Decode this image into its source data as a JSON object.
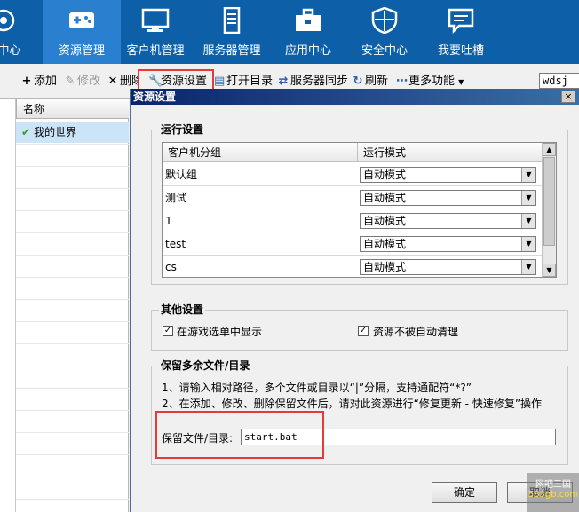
{
  "topnav": {
    "items": [
      {
        "label": "费中心",
        "icon": "eye-icon"
      },
      {
        "label": "资源管理",
        "icon": "gamepad-icon",
        "active": true
      },
      {
        "label": "客户机管理",
        "icon": "monitor-icon"
      },
      {
        "label": "服务器管理",
        "icon": "server-icon"
      },
      {
        "label": "应用中心",
        "icon": "toolbox-icon"
      },
      {
        "label": "安全中心",
        "icon": "shield-icon"
      },
      {
        "label": "我要吐槽",
        "icon": "chat-icon"
      }
    ]
  },
  "toolbar": {
    "add": "添加",
    "edit": "修改",
    "delete": "删除",
    "resource_settings": "资源设置",
    "open_dir": "打开目录",
    "server_sync": "服务器同步",
    "refresh": "刷新",
    "more": "更多功能",
    "search_value": "wdsj"
  },
  "left_list": {
    "header": "名称",
    "items": [
      "我的世界"
    ]
  },
  "dialog": {
    "title": "资源设置",
    "close": "×",
    "run_settings": {
      "title": "运行设置",
      "columns": [
        "客户机分组",
        "运行模式"
      ],
      "rows": [
        {
          "group": "默认组",
          "mode": "自动模式"
        },
        {
          "group": "测试",
          "mode": "自动模式"
        },
        {
          "group": "1",
          "mode": "自动模式"
        },
        {
          "group": "test",
          "mode": "自动模式"
        },
        {
          "group": "cs",
          "mode": "自动模式"
        }
      ]
    },
    "other_settings": {
      "title": "其他设置",
      "show_in_menu": {
        "label": "在游戏选单中显示",
        "checked": true
      },
      "no_auto_clean": {
        "label": "资源不被自动清理",
        "checked": true
      }
    },
    "keep_files": {
      "title": "保留多余文件/目录",
      "note1": "1、请输入相对路径，多个文件或目录以“|”分隔，支持通配符“*?”",
      "note2": "2、在添加、修改、删除保留文件后，请对此资源进行“修复更新 - 快速修复”操作",
      "label": "保留文件/目录:",
      "value": "start.bat"
    },
    "ok": "确定",
    "cancel": "取消"
  },
  "watermark": {
    "line1": "网吧三国",
    "line2": "583gb.com"
  }
}
